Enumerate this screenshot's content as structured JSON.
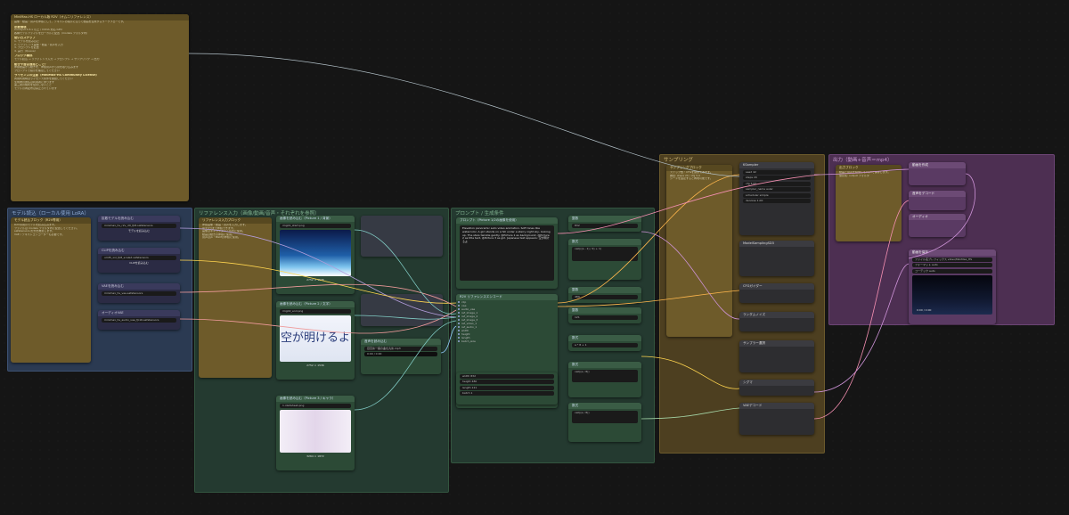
{
  "groups": {
    "model": "モデル読込（ローカル使用 LoRA）",
    "reference": "リファレンス入力（画像/動画/音声・それぞれを参照）",
    "prompt": "プロンプト / 生成条件",
    "sampling": "サンプリング",
    "output": "出力（動画+音声＝mp4）"
  },
  "readme": {
    "title": "MiniMax-HS ローカル版 R2V（オムニリファレンス）",
    "intro": "画像・動画・音声を参照として、テキストの指示に沿って動画を生成するワークフローです。",
    "h_req": "必要環境",
    "req_items": [
      "ComfyUI 0.3.x 以上 / CUDA 対応 GPU",
      "各種モデルファイルをローカルに配置（models フォルダ内）"
    ],
    "h_steps": "使い方ステップ",
    "steps": [
      "1. モデルを読み込む",
      "2. リファレンス画像・動画・音声を入力",
      "3. プロンプトを記述",
      "4. 実行（Queue）"
    ],
    "h_block": "ブロック構成",
    "block_desc": "モデル読込 → リファレンス入力 → プロンプト → サンプリング → 出力",
    "h_why": "動きや音は通常どこで？",
    "why_items": [
      "参照動画から動きを、参照音声から音を取り込みます",
      "プロンプトで指示を補足してください"
    ],
    "h_license": "ライセンスの注意（MiniMax-HS Community License）",
    "license_items": [
      "商用利用時はライセンス条件を確認してください",
      "生成物の責任は利用者にあります",
      "第三者の権利を侵害しないこと",
      "モデルの再配布は禁止されています"
    ]
  },
  "model_notes": {
    "title": "モデル読込ブロック（R2V専用）",
    "lines": [
      "R2V専用のモデルを読み込みます。",
      "ファイルは models フォルダ内に配置してください。",
      "safetensors 形式を推奨します。",
      "VAE / テキストエンコーダーも必要です。"
    ]
  },
  "loaders": [
    {
      "title": "拡散モデルを読み込む",
      "field": "minimax_hs_r2v_dit_fp8.safetensors",
      "btn": "モデルを読み込む"
    },
    {
      "title": "CLIPを読み込む",
      "field": "umt5_xxl_fp8_scaled.safetensors",
      "btn": "CLIPを読み込む"
    },
    {
      "title": "VAEを読み込む",
      "field": "minimax_hs_vae.safetensors",
      "btn": "VAEを読み込む"
    },
    {
      "title": "オーディオVAE",
      "field": "minimax_hs_audio_vae_fp16.safetensors",
      "btn": "読み込む"
    }
  ],
  "ref_notes": {
    "title": "リファレンス入力ブロック",
    "lines": [
      "参照画像・動画・音声を入力します。",
      "最大3つまで参照できます。",
      "画像はキャラクター・背景に使用。",
      "動画は動きの参照に使用。",
      "音声は声・BGMの参照に使用。"
    ]
  },
  "images": [
    {
      "title": "画像を読み込む（Picture 1 / 背景）",
      "file": "img01_start.png",
      "size": "2752 × 1536"
    },
    {
      "title": "画像を読み込む（Picture 2 / 文字）",
      "file": "img02_end.png",
      "size": "2752 × 1536",
      "text": "空が明けるよ"
    },
    {
      "title": "画像を読み込む（Picture 3 / キャラ）",
      "file": "1.ida3sheet.png",
      "size": "3264 × 1872"
    }
  ],
  "audio": {
    "title": "音声を読み込む",
    "file": "目覚め一緒の曲を丸め.mp3",
    "time": "0:00 / 0:00"
  },
  "prompt": {
    "title": "プロンプト（Picture 1/2の画像を使用）",
    "text": "Elevation panoramic auto video animation. Soft tones like watercolor. A girl stands on a hill under a starry night sky, looking up. The stars twinkle gently. @Picture 1 as background, @Picture 2 as title text, @Picture 3 as girl. Japanese text appears: 空が明けるよ"
  },
  "ref_encode": {
    "title": "R2V リファレンスエンコード",
    "ports": [
      "clip",
      "vae",
      "audio_vae",
      "ref_image_1",
      "ref_image_2",
      "ref_image_3",
      "ref_video_1",
      "ref_audio_1",
      "width",
      "height",
      "length",
      "batch_size"
    ]
  },
  "size_fields": [
    {
      "label": "width",
      "value": "832"
    },
    {
      "label": "height",
      "value": "480"
    },
    {
      "label": "length",
      "value": "121"
    },
    {
      "label": "batch",
      "value": "1"
    }
  ],
  "small_nodes": [
    {
      "title": "整数",
      "value": "832"
    },
    {
      "title": "整数",
      "value": "480"
    },
    {
      "title": "整数",
      "value": "121"
    },
    {
      "title": "数式",
      "value": "a * 24"
    },
    {
      "title": "数式",
      "value": "a * 8 + 1"
    }
  ],
  "formulas": [
    "ceil(((a - 1) / 4) + 1)",
    "ceil((a / 8))",
    "ceil((a / 8))"
  ],
  "sampling": {
    "title": "サンプリングブロック",
    "lines": [
      "ステップ数・CFGを調整できます。",
      "推奨: steps 20 / cfg 5.0",
      "シードを固定すると再現可能です。"
    ],
    "ksampler": {
      "title": "KSampler",
      "fields": [
        "seed 42",
        "steps 20",
        "cfg 5.00",
        "sampler_name euler",
        "scheduler simple",
        "denoise 1.00"
      ]
    },
    "other_nodes": [
      "ModelSamplingSD3",
      "CFGガイダー",
      "ランダムノイズ",
      "サンプラー選択",
      "シグマ",
      "VAEデコード"
    ]
  },
  "output": {
    "title": "出力ブロック",
    "lines": [
      "動画と音声を結合してmp4で保存します。",
      "保存先: output フォルダ"
    ],
    "nodes": [
      "動画を作成",
      "音声をデコード",
      "オーディオ"
    ],
    "save": {
      "title": "動画を保存",
      "fields": [
        "ファイル名プレフィックス video/MiniMax_HS",
        "フォーマット auto",
        "コーデック auto"
      ],
      "time": "0:00 / 0:00"
    }
  }
}
